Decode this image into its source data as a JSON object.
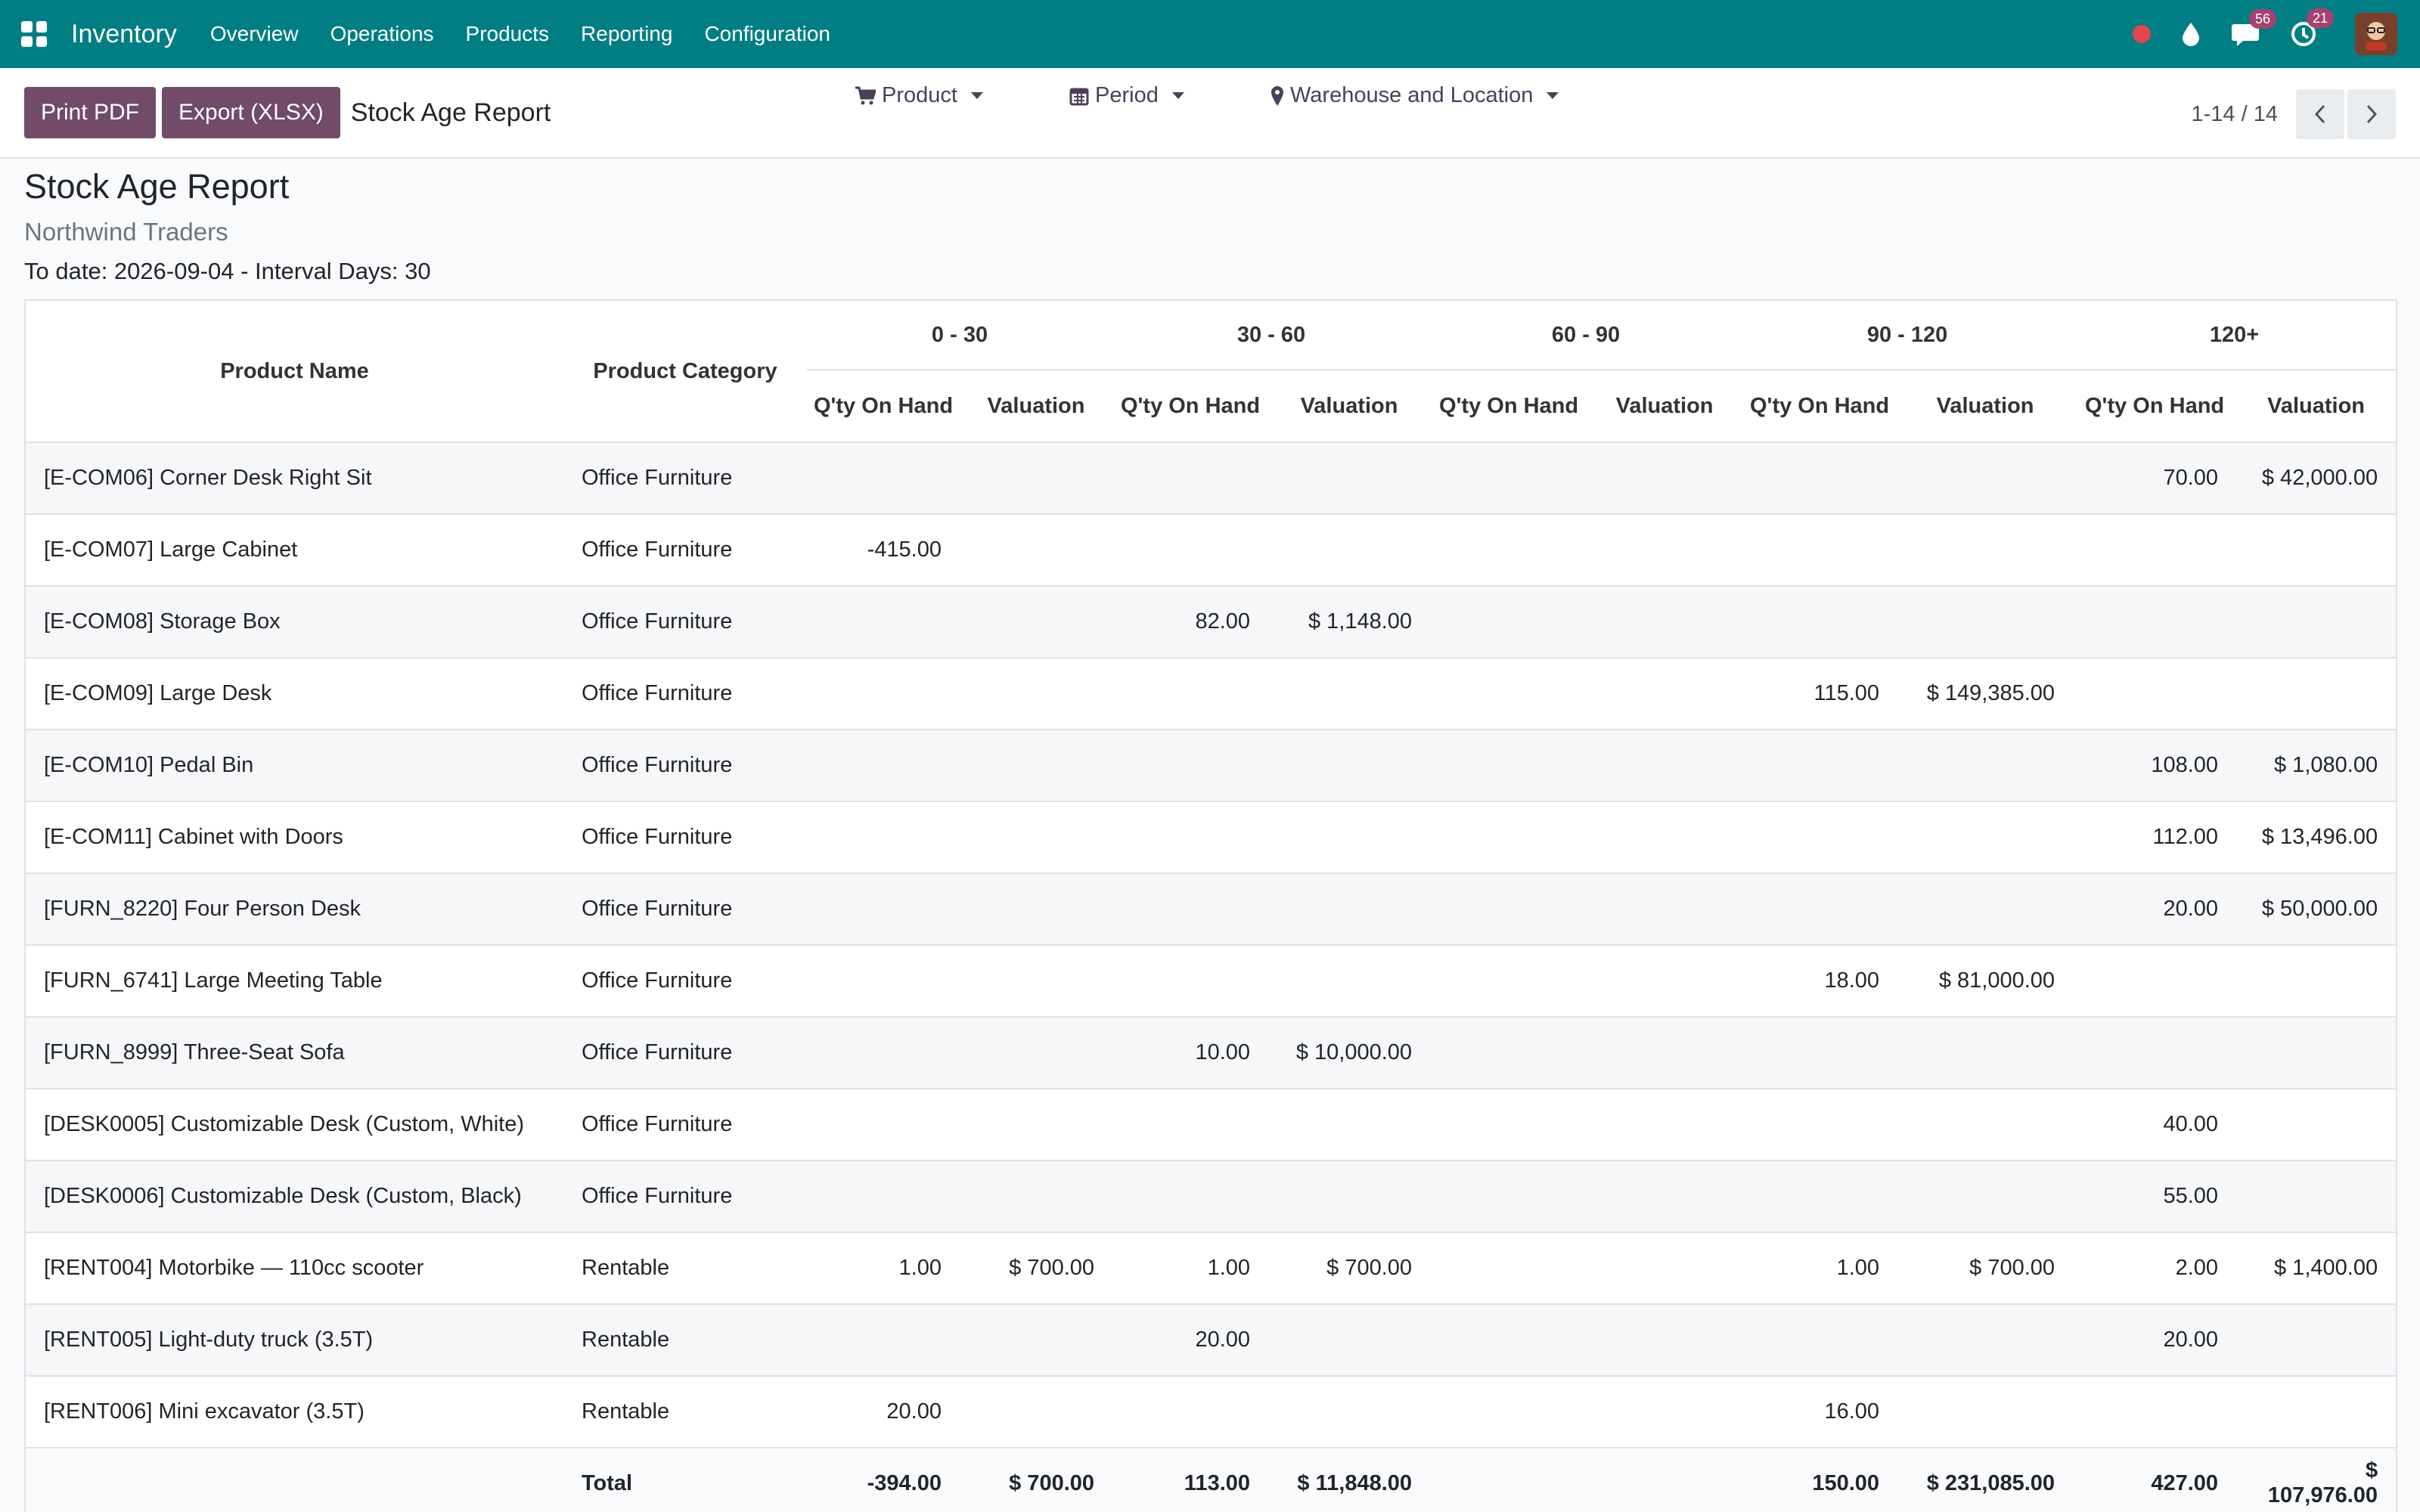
{
  "navbar": {
    "app_title": "Inventory",
    "menu": [
      "Overview",
      "Operations",
      "Products",
      "Reporting",
      "Configuration"
    ],
    "messages_count": "56",
    "activities_count": "21",
    "accent": "#017e84"
  },
  "control": {
    "print_pdf": "Print PDF",
    "export_xlsx": "Export (XLSX)",
    "title": "Stock Age Report",
    "filters": {
      "product": "Product",
      "period": "Period",
      "warehouse": "Warehouse and Location"
    },
    "pager": "1-14 / 14"
  },
  "report": {
    "title": "Stock Age Report",
    "company": "Northwind Traders",
    "meta": "To date: 2026-09-04 - Interval Days: 30",
    "headers": {
      "product_name": "Product Name",
      "product_category": "Product Category",
      "buckets": [
        "0 - 30",
        "30 - 60",
        "60 - 90",
        "90 - 120",
        "120+"
      ],
      "qty": "Q'ty On Hand",
      "valuation": "Valuation"
    },
    "rows": [
      {
        "name": "[E-COM06] Corner Desk Right Sit",
        "cat": "Office Furniture",
        "v": [
          "",
          "",
          "",
          "",
          "",
          "",
          "",
          "",
          "70.00",
          "$ 42,000.00"
        ]
      },
      {
        "name": "[E-COM07] Large Cabinet",
        "cat": "Office Furniture",
        "v": [
          "-415.00",
          "",
          "",
          "",
          "",
          "",
          "",
          "",
          "",
          ""
        ]
      },
      {
        "name": "[E-COM08] Storage Box",
        "cat": "Office Furniture",
        "v": [
          "",
          "",
          "82.00",
          "$ 1,148.00",
          "",
          "",
          "",
          "",
          "",
          ""
        ]
      },
      {
        "name": "[E-COM09] Large Desk",
        "cat": "Office Furniture",
        "v": [
          "",
          "",
          "",
          "",
          "",
          "",
          "115.00",
          "$ 149,385.00",
          "",
          ""
        ]
      },
      {
        "name": "[E-COM10] Pedal Bin",
        "cat": "Office Furniture",
        "v": [
          "",
          "",
          "",
          "",
          "",
          "",
          "",
          "",
          "108.00",
          "$ 1,080.00"
        ]
      },
      {
        "name": "[E-COM11] Cabinet with Doors",
        "cat": "Office Furniture",
        "v": [
          "",
          "",
          "",
          "",
          "",
          "",
          "",
          "",
          "112.00",
          "$ 13,496.00"
        ]
      },
      {
        "name": "[FURN_8220] Four Person Desk",
        "cat": "Office Furniture",
        "v": [
          "",
          "",
          "",
          "",
          "",
          "",
          "",
          "",
          "20.00",
          "$ 50,000.00"
        ]
      },
      {
        "name": "[FURN_6741] Large Meeting Table",
        "cat": "Office Furniture",
        "v": [
          "",
          "",
          "",
          "",
          "",
          "",
          "18.00",
          "$ 81,000.00",
          "",
          ""
        ]
      },
      {
        "name": "[FURN_8999] Three-Seat Sofa",
        "cat": "Office Furniture",
        "v": [
          "",
          "",
          "10.00",
          "$ 10,000.00",
          "",
          "",
          "",
          "",
          "",
          ""
        ]
      },
      {
        "name": "[DESK0005] Customizable Desk (Custom, White)",
        "cat": "Office Furniture",
        "v": [
          "",
          "",
          "",
          "",
          "",
          "",
          "",
          "",
          "40.00",
          ""
        ]
      },
      {
        "name": "[DESK0006] Customizable Desk (Custom, Black)",
        "cat": "Office Furniture",
        "v": [
          "",
          "",
          "",
          "",
          "",
          "",
          "",
          "",
          "55.00",
          ""
        ]
      },
      {
        "name": "[RENT004] Motorbike — 110cc scooter",
        "cat": "Rentable",
        "v": [
          "1.00",
          "$ 700.00",
          "1.00",
          "$ 700.00",
          "",
          "",
          "1.00",
          "$ 700.00",
          "2.00",
          "$ 1,400.00"
        ]
      },
      {
        "name": "[RENT005] Light-duty truck (3.5T)",
        "cat": "Rentable",
        "v": [
          "",
          "",
          "20.00",
          "",
          "",
          "",
          "",
          "",
          "20.00",
          ""
        ]
      },
      {
        "name": "[RENT006] Mini excavator (3.5T)",
        "cat": "Rentable",
        "v": [
          "20.00",
          "",
          "",
          "",
          "",
          "",
          "16.00",
          "",
          "",
          ""
        ]
      }
    ],
    "total": {
      "label": "Total",
      "v": [
        "-394.00",
        "$ 700.00",
        "113.00",
        "$ 11,848.00",
        "",
        "",
        "150.00",
        "$ 231,085.00",
        "427.00",
        "$ 107,976.00"
      ]
    }
  }
}
